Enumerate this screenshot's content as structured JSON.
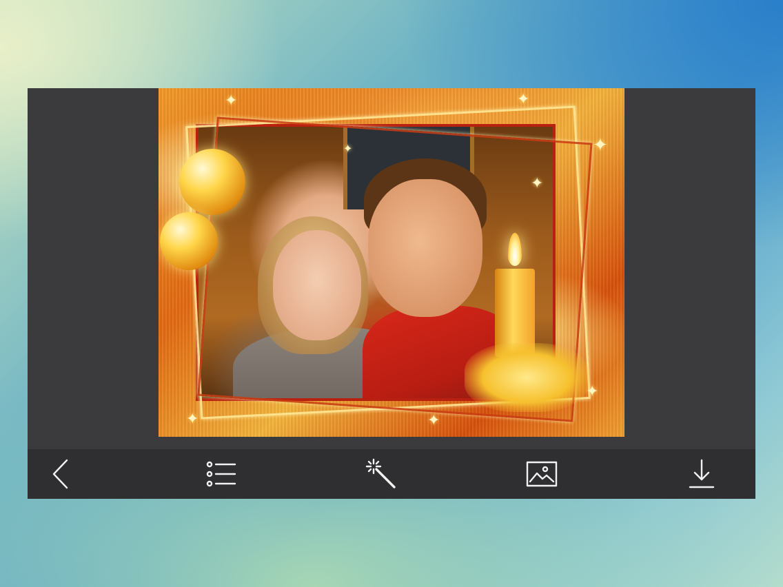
{
  "toolbar": {
    "buttons": [
      {
        "name": "back-button",
        "icon": "chevron-left-icon"
      },
      {
        "name": "frames-list-button",
        "icon": "list-icon"
      },
      {
        "name": "effects-button",
        "icon": "magic-wand-icon"
      },
      {
        "name": "gallery-button",
        "icon": "image-icon"
      },
      {
        "name": "download-button",
        "icon": "download-icon"
      }
    ],
    "icon_color": "#f2f2f2",
    "bar_color": "#2f2f31"
  },
  "canvas": {
    "background_color": "#3b3b3d",
    "frame_theme": "christmas-candle-golden-frame",
    "photo_content": "couple-portrait"
  }
}
